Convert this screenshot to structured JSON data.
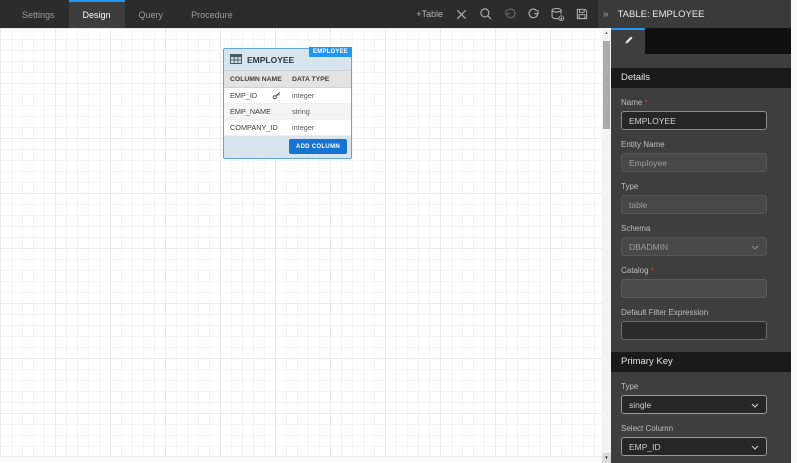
{
  "toolbar": {
    "tabs": [
      {
        "label": "Settings"
      },
      {
        "label": "Design"
      },
      {
        "label": "Query"
      },
      {
        "label": "Procedure"
      }
    ],
    "active_tab": "Design",
    "add_table_label": "+Table"
  },
  "panel": {
    "header": "TABLE: EMPLOYEE",
    "details": {
      "title": "Details",
      "name": {
        "label": "Name",
        "value": "EMPLOYEE",
        "required": true
      },
      "entity_name": {
        "label": "Entity Name",
        "value": "Employee"
      },
      "type": {
        "label": "Type",
        "value": "table"
      },
      "schema": {
        "label": "Schema",
        "value": "DBADMIN"
      },
      "catalog": {
        "label": "Catalog",
        "value": "",
        "required": true
      },
      "default_filter": {
        "label": "Default Filter Expression",
        "value": ""
      }
    },
    "primary_key": {
      "title": "Primary Key",
      "type": {
        "label": "Type",
        "value": "single"
      },
      "select_column": {
        "label": "Select Column",
        "value": "EMP_ID"
      }
    }
  },
  "canvas": {
    "entity": {
      "badge": "EMPLOYEE",
      "title": "EMPLOYEE",
      "header": {
        "column_name": "COLUMN NAME",
        "data_type": "DATA TYPE"
      },
      "rows": [
        {
          "name": "EMP_ID",
          "type": "integer",
          "primary_key": true
        },
        {
          "name": "EMP_NAME",
          "type": "string",
          "primary_key": false
        },
        {
          "name": "COMPANY_ID",
          "type": "integer",
          "primary_key": false
        }
      ],
      "add_column_label": "ADD COLUMN"
    }
  },
  "icons": {
    "collapse": "»",
    "scroll_up": "▲",
    "scroll_down": "▼"
  },
  "misc": {
    "required_mark": "*"
  },
  "colors": {
    "accent": "#2196f3",
    "badge_blue": "#2196f3",
    "button_blue": "#1673d1",
    "toolbar_bg": "#2c2c2c",
    "panel_bg": "#3e3e3e",
    "section_bar_bg": "#1a1a1a",
    "required_red": "#e53935",
    "entity_border": "#64a4d8",
    "entity_header_bg": "#d9e5ec"
  }
}
